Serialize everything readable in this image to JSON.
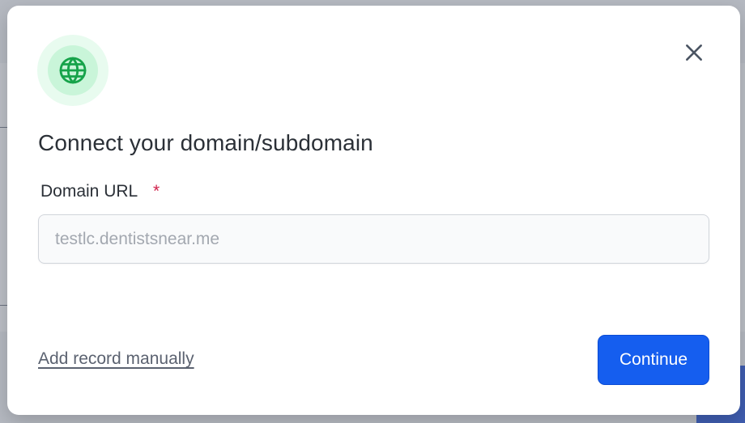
{
  "modal": {
    "title": "Connect your domain/subdomain",
    "icon": "globe-icon",
    "close_icon": "close-icon",
    "field": {
      "label": "Domain URL",
      "required_mark": "*",
      "placeholder": "testlc.dentistsnear.me",
      "value": ""
    },
    "manual_link_label": "Add record manually",
    "continue_label": "Continue"
  },
  "colors": {
    "accent": "#155eef",
    "icon_green": "#16a34a",
    "icon_bg": "#c9f5d9",
    "required": "#d0214b"
  }
}
